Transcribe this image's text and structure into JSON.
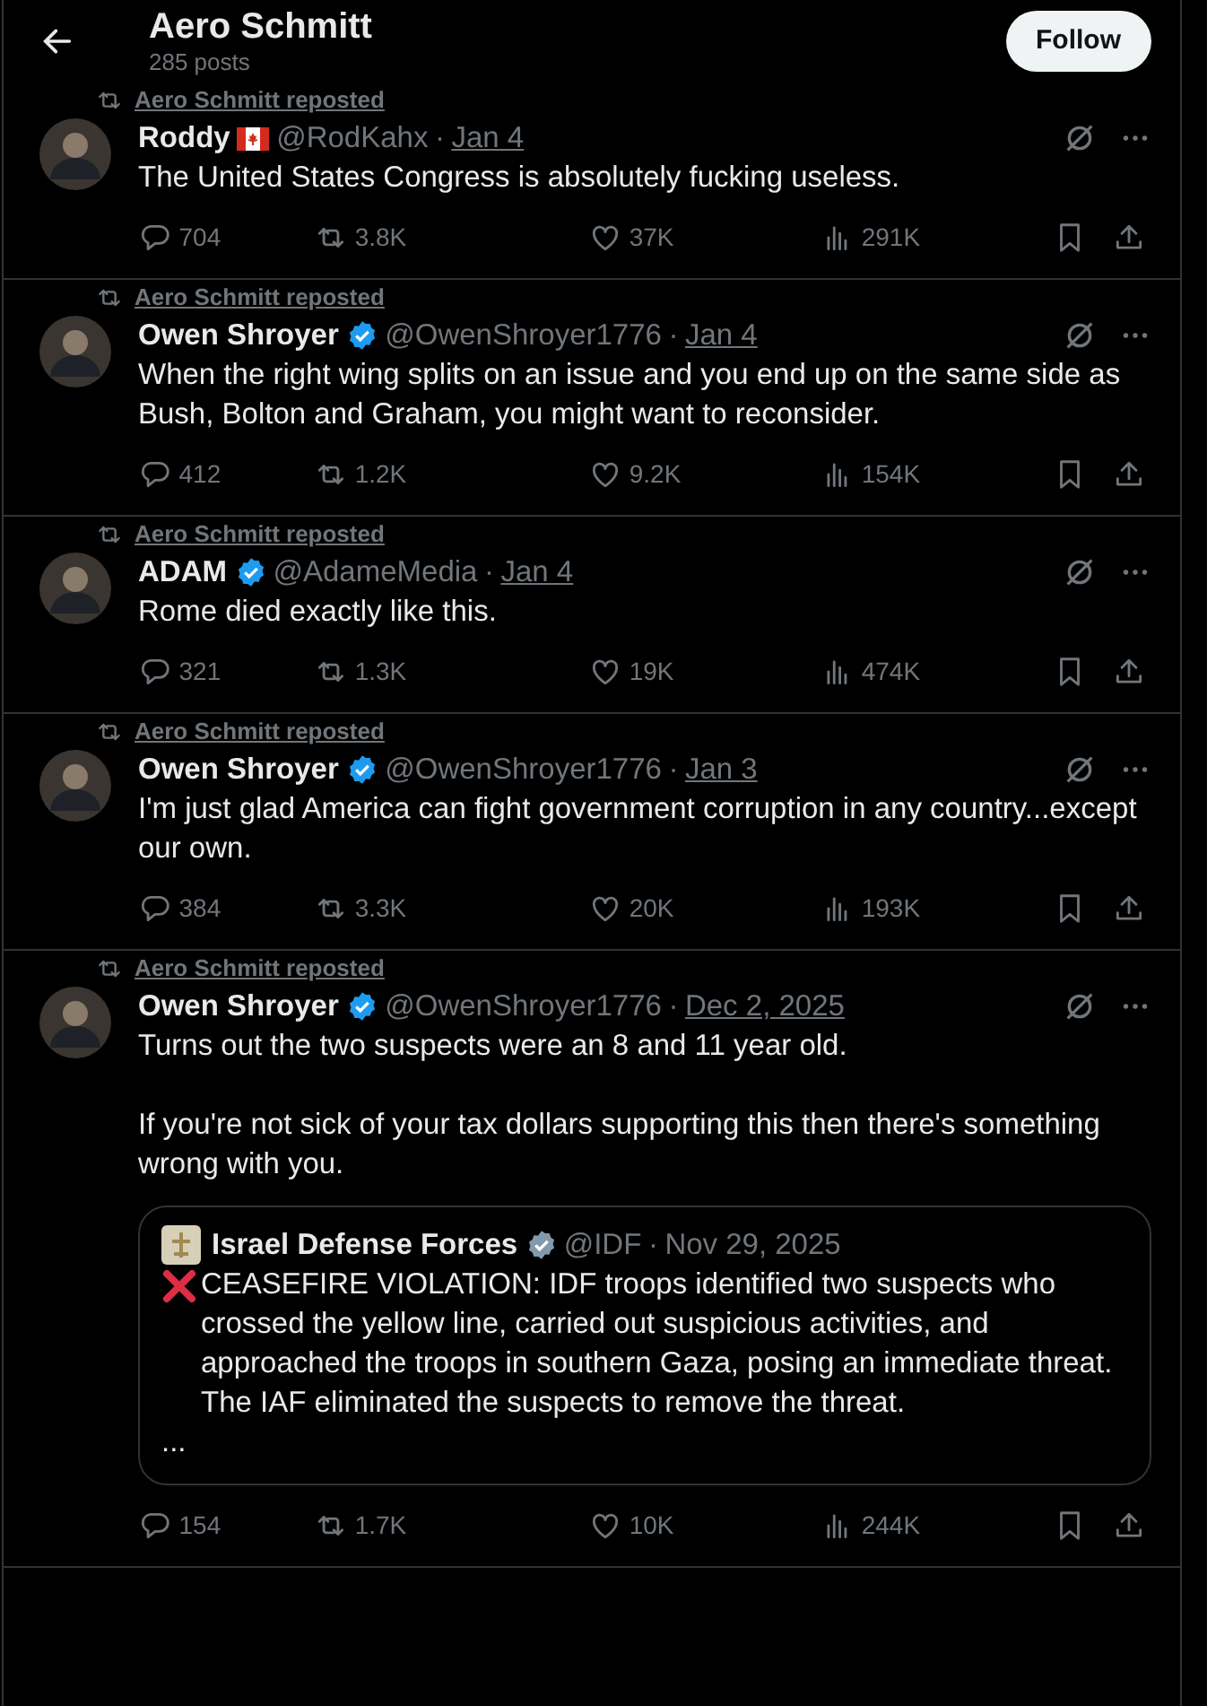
{
  "header": {
    "title": "Aero Schmitt",
    "subtitle": "285 posts",
    "follow_button": "Follow"
  },
  "posts": [
    {
      "repost_label": "Aero Schmitt reposted",
      "name": "Roddy",
      "flag": true,
      "verified": false,
      "separator": "·",
      "handle": "@RodKahx",
      "date": "Jan 4",
      "text": [
        "The United States Congress is absolutely fucking useless."
      ],
      "stats": {
        "replies": "704",
        "reposts": "3.8K",
        "likes": "37K",
        "views": "291K"
      }
    },
    {
      "repost_label": "Aero Schmitt reposted",
      "name": "Owen Shroyer",
      "flag": false,
      "verified": true,
      "separator": "·",
      "handle": "@OwenShroyer1776",
      "date": "Jan 4",
      "text": [
        "When the right wing splits on an issue and you end up on the same side as Bush, Bolton and Graham, you might want to reconsider."
      ],
      "stats": {
        "replies": "412",
        "reposts": "1.2K",
        "likes": "9.2K",
        "views": "154K"
      }
    },
    {
      "repost_label": "Aero Schmitt reposted",
      "name": "ADAM",
      "flag": false,
      "verified": true,
      "separator": "·",
      "handle": "@AdameMedia",
      "date": "Jan 4",
      "text": [
        "Rome died exactly like this."
      ],
      "stats": {
        "replies": "321",
        "reposts": "1.3K",
        "likes": "19K",
        "views": "474K"
      }
    },
    {
      "repost_label": "Aero Schmitt reposted",
      "name": "Owen Shroyer",
      "flag": false,
      "verified": true,
      "separator": "·",
      "handle": "@OwenShroyer1776",
      "date": "Jan 3",
      "text": [
        "I'm just glad America can fight government corruption in any country...except our own."
      ],
      "stats": {
        "replies": "384",
        "reposts": "3.3K",
        "likes": "20K",
        "views": "193K"
      }
    },
    {
      "repost_label": "Aero Schmitt reposted",
      "name": "Owen Shroyer",
      "flag": false,
      "verified": true,
      "separator": "·",
      "handle": "@OwenShroyer1776",
      "date": "Dec 2, 2025",
      "text": [
        "Turns out the two suspects were an 8 and 11 year old.",
        "If you're not sick of your tax dollars supporting this then there's something wrong with you."
      ],
      "quote": {
        "name": "Israel Defense Forces",
        "verified": true,
        "color": "#829aab",
        "separator": "·",
        "handle": "@IDF",
        "date": "Nov 29, 2025",
        "text": [
          "CEASEFIRE VIOLATION: IDF troops identified two suspects who crossed the yellow line, carried out suspicious activities, and approached the troops in southern Gaza, posing an immediate threat. The IAF eliminated the suspects to remove the threat.",
          "..."
        ]
      },
      "stats": {
        "replies": "154",
        "reposts": "1.7K",
        "likes": "10K",
        "views": "244K"
      }
    }
  ]
}
